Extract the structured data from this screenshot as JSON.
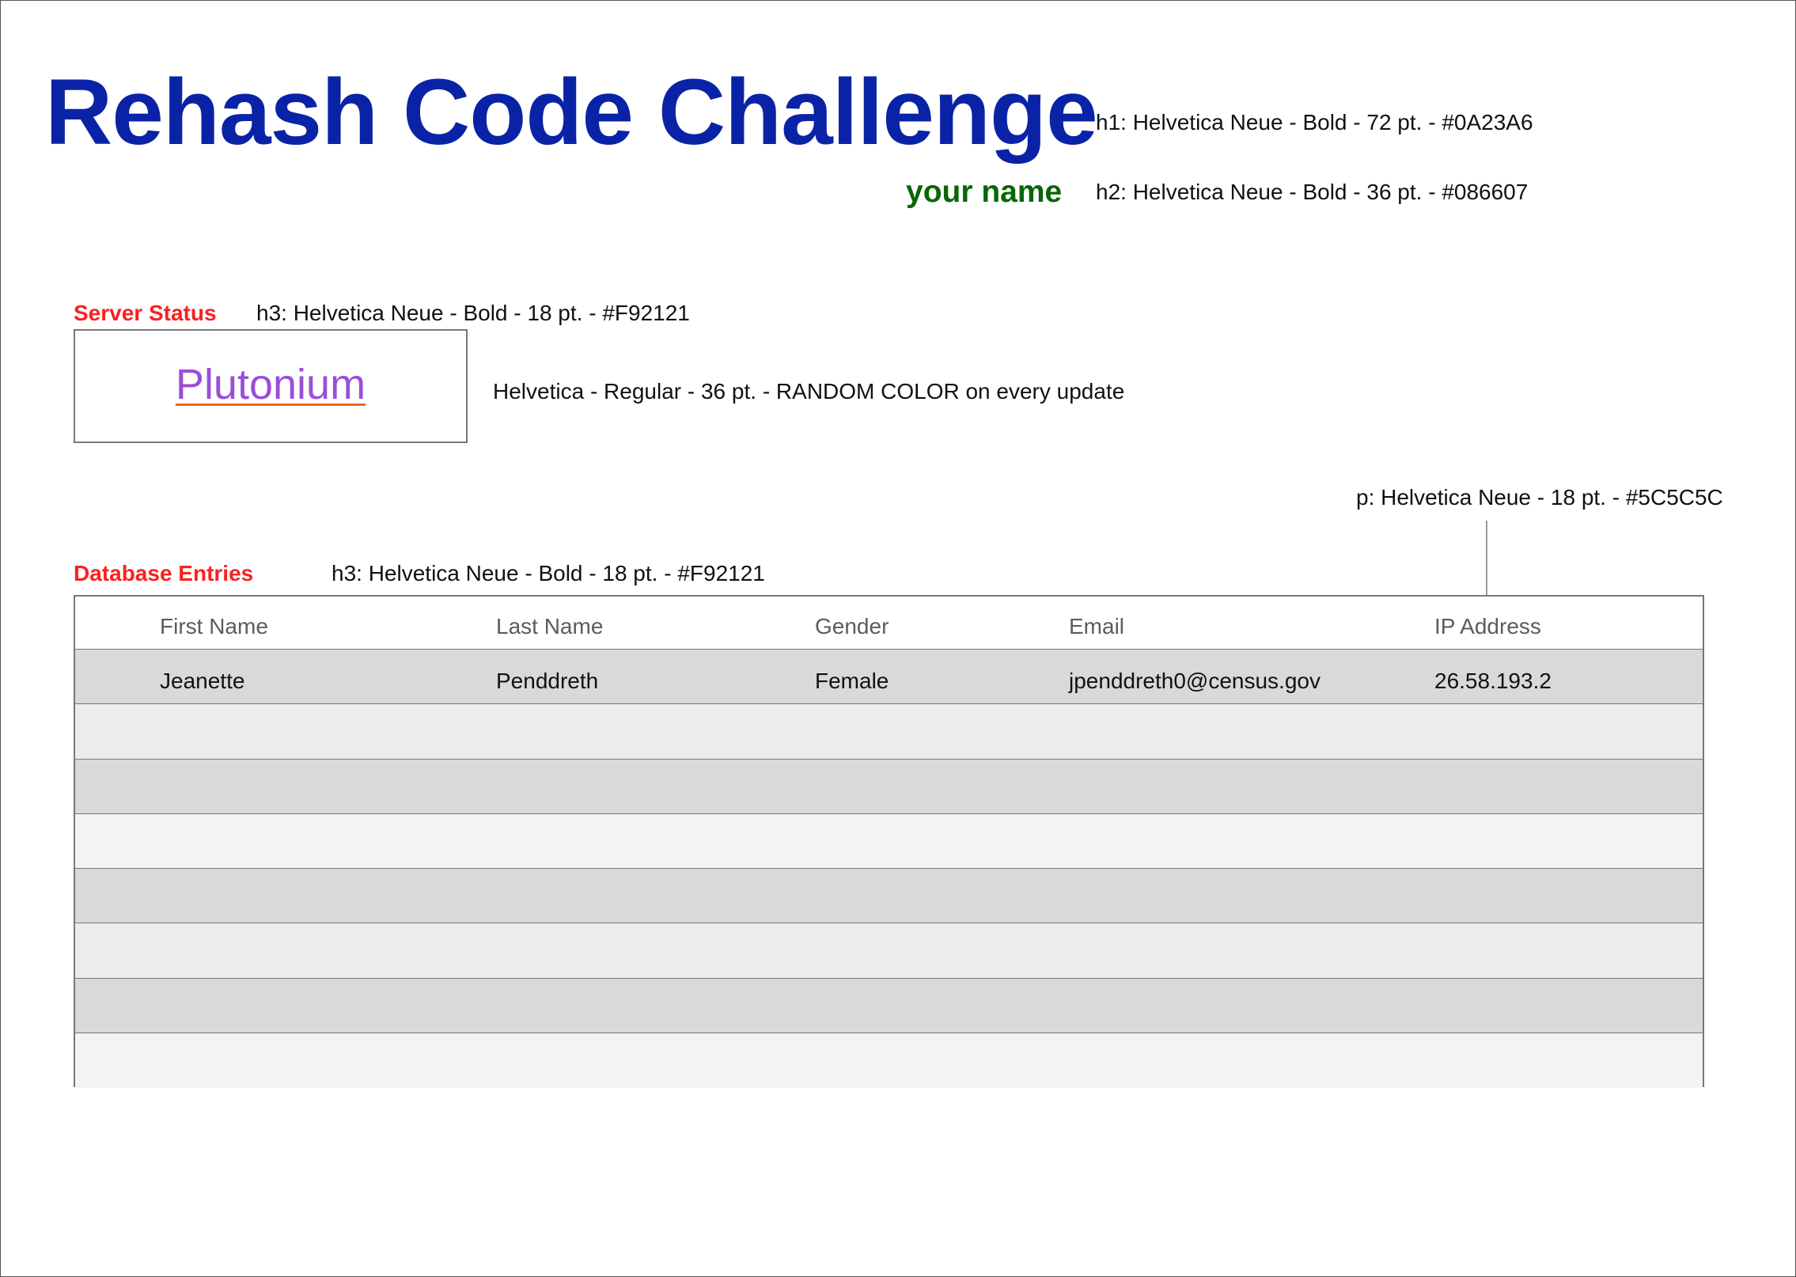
{
  "title": "Rehash Code Challenge",
  "subtitle": "your name",
  "annotations": {
    "h1": "h1: Helvetica Neue - Bold - 72 pt. - #0A23A6",
    "h2": "h2: Helvetica Neue - Bold - 36 pt. - #086607",
    "h3_server": "h3: Helvetica Neue - Bold - 18 pt. - #F92121",
    "status": "Helvetica - Regular - 36 pt. - RANDOM COLOR on every update",
    "p": "p: Helvetica Neue - 18 pt. - #5C5C5C",
    "h3_db": "h3: Helvetica Neue - Bold - 18 pt. - #F92121"
  },
  "server_status": {
    "heading": "Server Status",
    "value": "Plutonium",
    "text_color": "#9A4ED8",
    "underline_color": "#E86A1A"
  },
  "database": {
    "heading": "Database Entries",
    "columns": [
      "First Name",
      "Last Name",
      "Gender",
      "Email",
      "IP Address"
    ],
    "rows": [
      [
        "Jeanette",
        "Penddreth",
        "Female",
        "jpenddreth0@census.gov",
        "26.58.193.2"
      ],
      [
        "",
        "",
        "",
        "",
        ""
      ],
      [
        "",
        "",
        "",
        "",
        ""
      ],
      [
        "",
        "",
        "",
        "",
        ""
      ],
      [
        "",
        "",
        "",
        "",
        ""
      ],
      [
        "",
        "",
        "",
        "",
        ""
      ],
      [
        "",
        "",
        "",
        "",
        ""
      ],
      [
        "",
        "",
        "",
        "",
        ""
      ]
    ],
    "row_colors": [
      "#D9D9D9",
      "#ECECEC",
      "#D9D9D9",
      "#F3F3F3",
      "#D9D9D9",
      "#ECECEC",
      "#D9D9D9",
      "#F3F3F3"
    ]
  },
  "colors": {
    "h1": "#0A23A6",
    "h2": "#086607",
    "h3": "#F92121",
    "p": "#5C5C5C"
  }
}
